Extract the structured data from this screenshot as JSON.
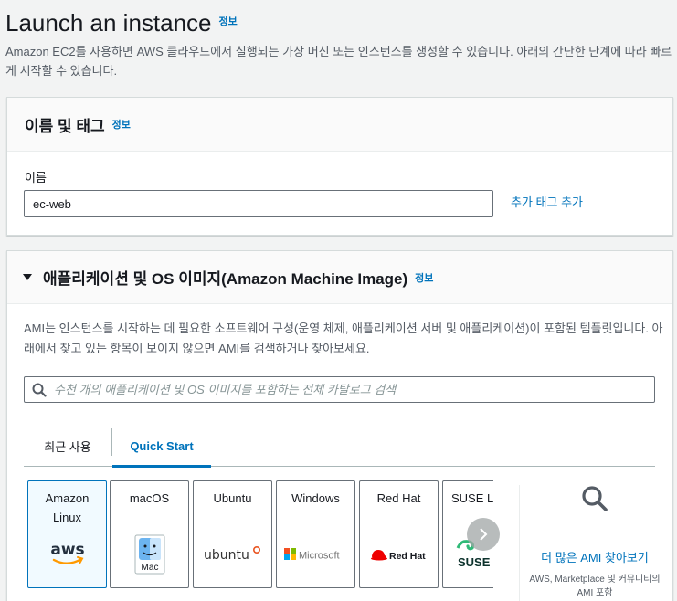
{
  "page": {
    "title": "Launch an instance",
    "title_info": "정보",
    "description": "Amazon EC2를 사용하면 AWS 클라우드에서 실행되는 가상 머신 또는 인스턴스를 생성할 수 있습니다. 아래의 간단한 단계에 따라 빠르게 시작할 수 있습니다."
  },
  "name_tags": {
    "title": "이름 및 태그",
    "info": "정보",
    "name_label": "이름",
    "name_value": "ec-web",
    "add_tag_link": "추가 태그 추가"
  },
  "ami": {
    "title": "애플리케이션 및 OS 이미지(Amazon Machine Image)",
    "info": "정보",
    "description": "AMI는 인스턴스를 시작하는 데 필요한 소프트웨어 구성(운영 체제, 애플리케이션 서버 및 애플리케이션)이 포함된 템플릿입니다. 아래에서 찾고 있는 항목이 보이지 않으면 AMI를 검색하거나 찾아보세요.",
    "search_placeholder": "수천 개의 애플리케이션 및 OS 이미지를 포함하는 전체 카탈로그 검색",
    "tabs": [
      {
        "label": "최근 사용",
        "active": false
      },
      {
        "label": "Quick Start",
        "active": true
      }
    ],
    "cards": [
      {
        "label": "Amazon\nLinux",
        "logo": "aws-logo",
        "logo_text": "aws",
        "selected": true
      },
      {
        "label": "macOS",
        "logo": "mac-finder-logo",
        "logo_text": "Mac",
        "selected": false
      },
      {
        "label": "Ubuntu",
        "logo": "ubuntu-logo",
        "logo_text": "ubuntu",
        "selected": false
      },
      {
        "label": "Windows",
        "logo": "microsoft-logo",
        "logo_text": "Microsoft",
        "selected": false
      },
      {
        "label": "Red Hat",
        "logo": "redhat-logo",
        "logo_text": "Red Hat",
        "selected": false
      },
      {
        "label": "SUSE Linux",
        "logo": "suse-logo",
        "logo_text": "SUSE",
        "selected": false
      }
    ],
    "more_link": "더 많은 AMI 찾아보기",
    "more_sub": "AWS, Marketplace 및 커뮤니티의 AMI 포함"
  },
  "colors": {
    "link": "#0073bb",
    "aws_orange": "#ff9900",
    "ubuntu_orange": "#e95420",
    "redhat_red": "#ee0000",
    "suse_green": "#30ba78"
  }
}
